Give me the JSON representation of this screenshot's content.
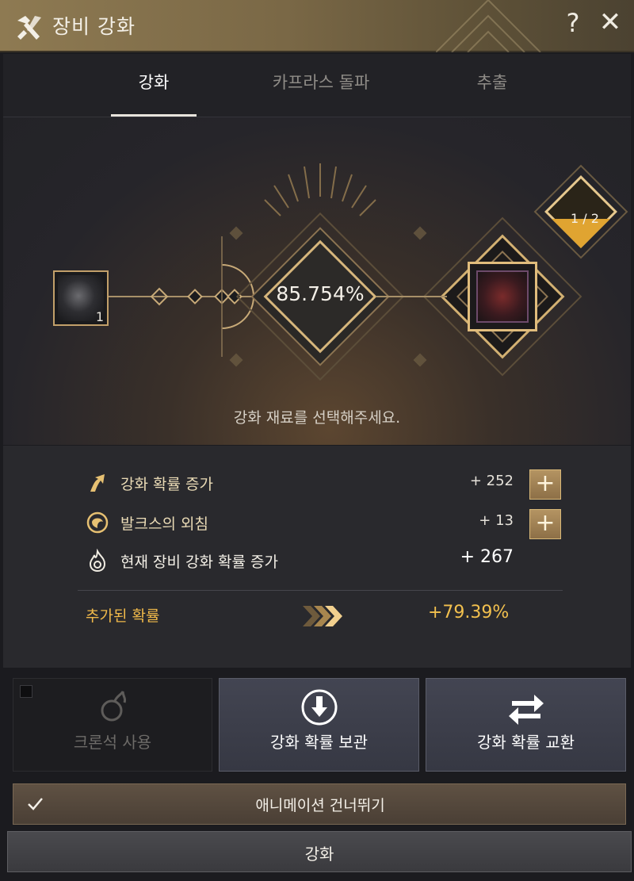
{
  "window": {
    "title": "장비 강화",
    "help_icon": "help-icon",
    "close_icon": "close-icon"
  },
  "tabs": [
    {
      "label": "강화",
      "active": true
    },
    {
      "label": "카프라스 돌파",
      "active": false
    },
    {
      "label": "추출",
      "active": false
    }
  ],
  "stage": {
    "material_count": "1",
    "success_rate": "85.754%",
    "step": "1 / 2",
    "hint": "강화 재료를 선택해주세요."
  },
  "info": {
    "rows": [
      {
        "label": "강화 확률 증가",
        "value": "+ 252",
        "icon": "arrow-up-icon"
      },
      {
        "label": "발크스의 외침",
        "value": "+ 13",
        "icon": "valks-icon"
      },
      {
        "label": "현재 장비 강화 확률 증가",
        "value": "+ 267",
        "icon": "flame-icon"
      }
    ],
    "added_label": "추가된 확률",
    "added_value": "+79.39%"
  },
  "buttons": {
    "cron": "크론석 사용",
    "store": "강화 확률 보관",
    "exchange": "강화 확률 교환",
    "skip_animation": "애니메이션 건너뛰기",
    "enhance": "강화"
  },
  "colors": {
    "accent_gold": "#f2c04e",
    "frame_gold": "#c2a06a",
    "title_bar": "#8e7a52"
  }
}
